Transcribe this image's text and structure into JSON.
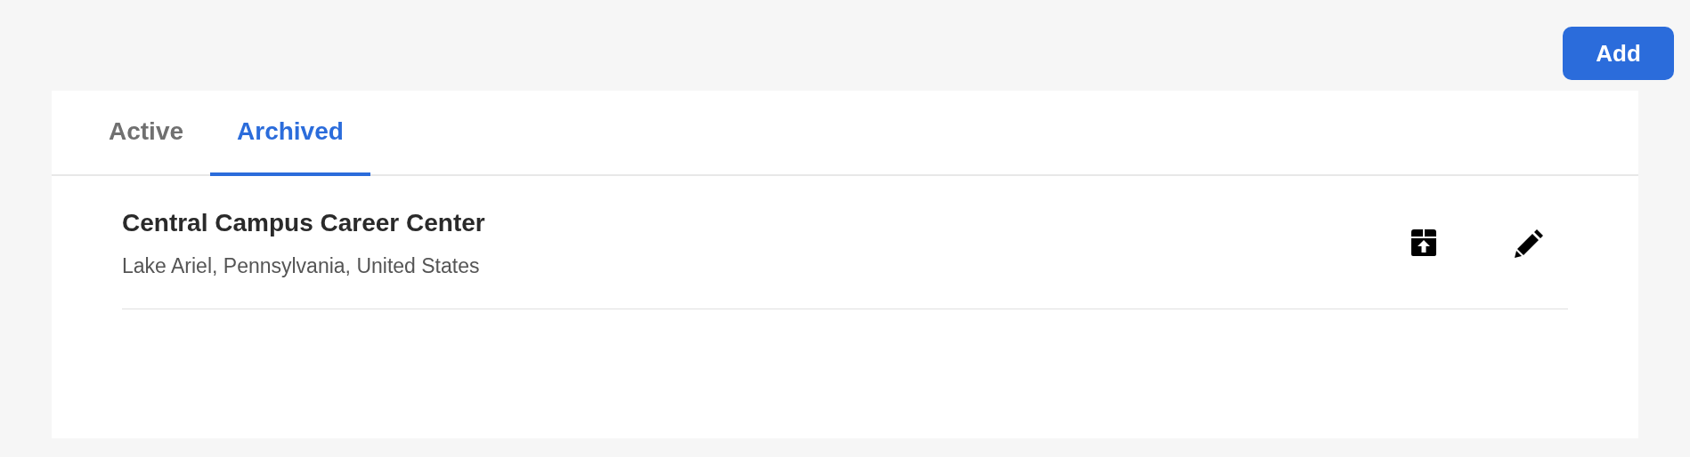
{
  "add_button": {
    "label": "Add"
  },
  "tabs": [
    {
      "label": "Active",
      "selected": false
    },
    {
      "label": "Archived",
      "selected": true
    }
  ],
  "items": [
    {
      "title": "Central Campus Career Center",
      "location": "Lake Ariel, Pennsylvania, United States"
    }
  ]
}
